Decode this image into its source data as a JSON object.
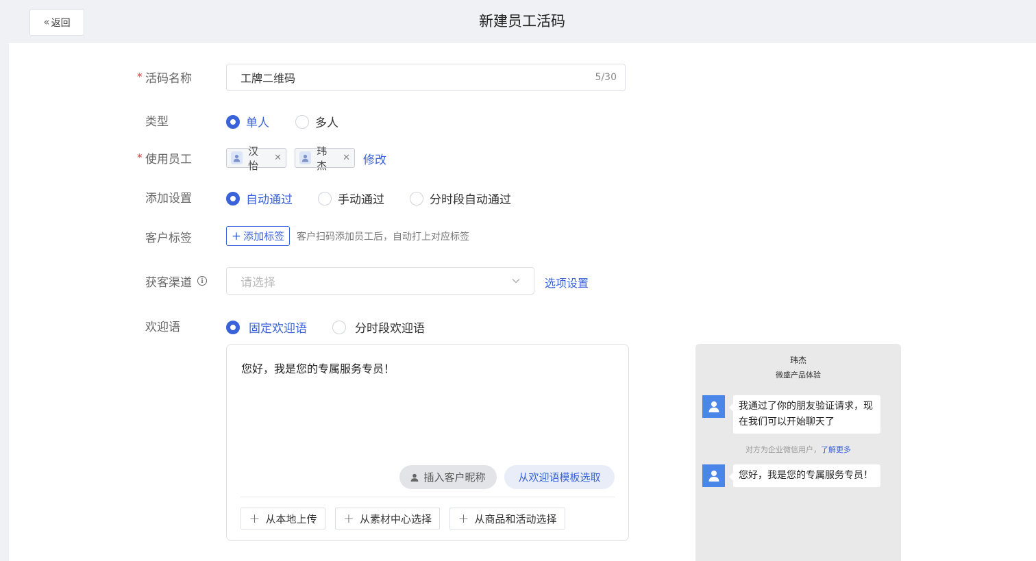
{
  "header": {
    "back_label": "返回",
    "title": "新建员工活码"
  },
  "form": {
    "name": {
      "label": "活码名称",
      "required": true,
      "value": "工牌二维码",
      "counter": "5/30"
    },
    "type": {
      "label": "类型",
      "options": [
        "单人",
        "多人"
      ],
      "selected": "单人"
    },
    "staff": {
      "label": "使用员工",
      "required": true,
      "chips": [
        "汉怡",
        "玮杰"
      ],
      "modify_label": "修改"
    },
    "add_setting": {
      "label": "添加设置",
      "options": [
        "自动通过",
        "手动通过",
        "分时段自动通过"
      ],
      "selected": "自动通过"
    },
    "customer_tags": {
      "label": "客户标签",
      "button_label": "添加标签",
      "hint": "客户扫码添加员工后，自动打上对应标签"
    },
    "channel": {
      "label": "获客渠道",
      "placeholder": "请选择",
      "settings_link": "选项设置"
    },
    "welcome": {
      "label": "欢迎语",
      "options": [
        "固定欢迎语",
        "分时段欢迎语"
      ],
      "selected": "固定欢迎语",
      "text": "您好，我是您的专属服务专员！",
      "insert_nickname_label": "插入客户昵称",
      "from_template_label": "从欢迎语模板选取",
      "upload_buttons": [
        "从本地上传",
        "从素材中心选择",
        "从商品和活动选择"
      ]
    }
  },
  "preview": {
    "contact_name": "玮杰",
    "corp_name": "微盛产品体验",
    "messages": [
      "我通过了你的朋友验证请求，现在我们可以开始聊天了",
      "您好，我是您的专属服务专员！"
    ],
    "system_note": "对方为企业微信用户，",
    "system_link": "了解更多"
  },
  "colors": {
    "accent": "#3a63d9",
    "required": "#e0393e",
    "avatar": "#4a86e8"
  }
}
